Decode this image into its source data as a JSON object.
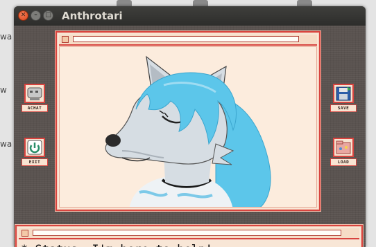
{
  "window": {
    "title": "Anthrotari"
  },
  "desktop": {
    "fragments": [
      "wa",
      "w",
      "wa"
    ]
  },
  "side_buttons": {
    "chat": {
      "label": "ACHAT",
      "icon": "chat-bubble-icon"
    },
    "exit": {
      "label": "EXIT",
      "icon": "power-icon"
    },
    "save": {
      "label": "SAVE",
      "icon": "floppy-disk-icon"
    },
    "load": {
      "label": "LOAD",
      "icon": "folder-icon"
    }
  },
  "avatar": {
    "icon": "wolf-avatar-icon",
    "colors": {
      "hair": "#5cc6ea",
      "fur": "#d6dde3",
      "nose": "#2b2b2b",
      "collar": "#1a1a1a"
    }
  },
  "status": {
    "text": "* Status: I'm here to help!"
  },
  "theme": {
    "panel_border": "#d8443f",
    "panel_fill": "#f8e6d6",
    "window_bg": "#5a5350"
  }
}
